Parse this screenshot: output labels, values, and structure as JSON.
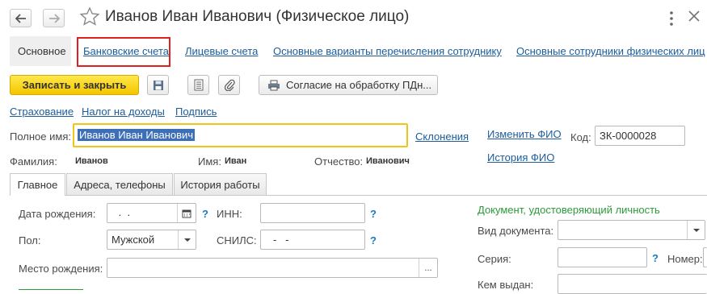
{
  "window": {
    "title": "Иванов Иван Иванович (Физическое лицо)"
  },
  "top_tabs": [
    {
      "label": "Основное"
    },
    {
      "label": "Банковские счета"
    },
    {
      "label": "Лицевые счета"
    },
    {
      "label": "Основные варианты перечисления сотруднику"
    },
    {
      "label": "Основные сотрудники физических лиц"
    }
  ],
  "toolbar": {
    "save_close": "Записать и закрыть",
    "consent": "Согласие на обработку ПДн..."
  },
  "sublinks": [
    "Страхование",
    "Налог на доходы",
    "Подпись"
  ],
  "person": {
    "full_name_label": "Полное имя:",
    "full_name_value": "Иванов Иван Иванович",
    "declensions": "Склонения",
    "change_fio": "Изменить ФИО",
    "history_fio": "История ФИО",
    "code_label": "Код:",
    "code_value": "ЗК-0000028",
    "surname_label": "Фамилия:",
    "surname_value": "Иванов",
    "name_label": "Имя:",
    "name_value": "Иван",
    "patronymic_label": "Отчество:",
    "patronymic_value": "Иванович"
  },
  "inner_tabs": [
    "Главное",
    "Адреса, телефоны",
    "История работы"
  ],
  "main": {
    "birth_date_label": "Дата рождения:",
    "birth_date_value": " .  .",
    "inn_label": "ИНН:",
    "snils_label": "СНИЛС:",
    "snils_value": "-   -",
    "gender_label": "Пол:",
    "gender_value": "Мужской",
    "birthplace_label": "Место рождения:",
    "ellipsis": "...",
    "question": "?"
  },
  "document": {
    "heading": "Документ, удостоверяющий личность",
    "doc_type_label": "Вид документа:",
    "series_label": "Серия:",
    "number_label": "Номер:",
    "issued_by_label": "Кем выдан:"
  }
}
